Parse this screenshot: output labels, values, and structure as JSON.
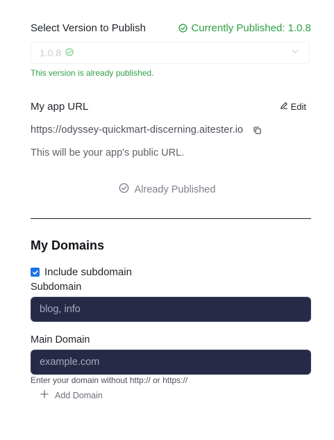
{
  "publish": {
    "title": "Select Version to Publish",
    "currently_published": "Currently Published: 1.0.8",
    "selected_version": "1.0.8",
    "note": "This version is already published."
  },
  "app_url": {
    "label": "My app URL",
    "edit_label": "Edit",
    "url": "https://odyssey-quickmart-discerning.aitester.io",
    "hint": "This will be your app's public URL.",
    "status": "Already Published"
  },
  "domains": {
    "title": "My Domains",
    "include_subdomain_label": "Include subdomain",
    "include_subdomain_checked": true,
    "subdomain_label": "Subdomain",
    "subdomain_placeholder": "blog, info",
    "main_domain_label": "Main Domain",
    "main_domain_placeholder": "example.com",
    "hint": "Enter your domain without http:// or https://",
    "add_label": "Add Domain"
  },
  "colors": {
    "success": "#2f9e44",
    "input_bg": "#262a47",
    "checkbox": "#1a73e8"
  }
}
